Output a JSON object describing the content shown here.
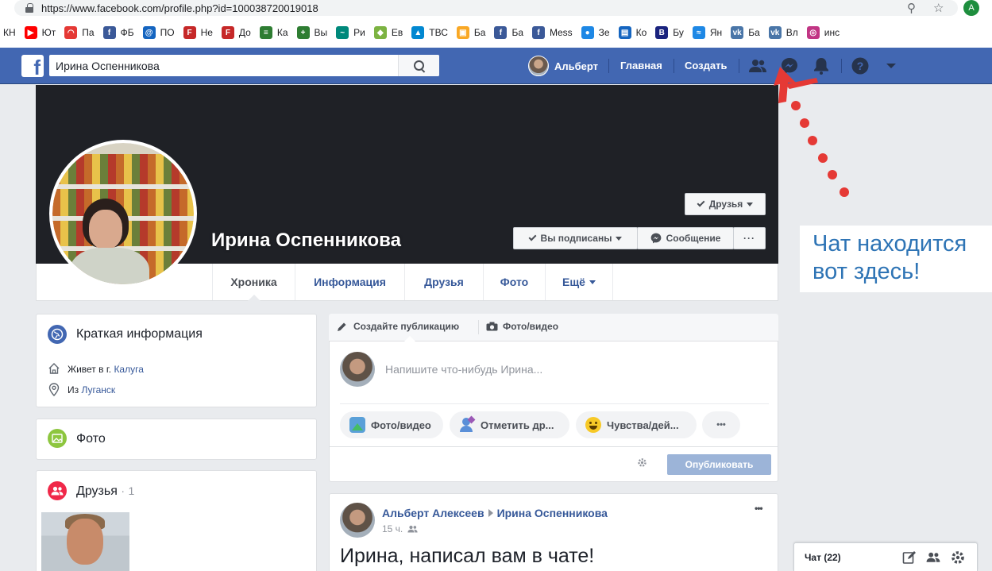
{
  "browser": {
    "url": "https://www.facebook.com/profile.php?id=100038720019018",
    "profile_initial": "A",
    "bookmarks": [
      {
        "label": "КН",
        "icon": "",
        "color": ""
      },
      {
        "label": "Ют",
        "icon": "youtube-icon",
        "color": "#ff0000"
      },
      {
        "label": "Па",
        "icon": "rainbow-icon",
        "color": "#e53935"
      },
      {
        "label": "ФБ",
        "icon": "facebook-icon",
        "color": "#3b5998"
      },
      {
        "label": "ПО",
        "icon": "mail-at-icon",
        "color": "#1565c0"
      },
      {
        "label": "Не",
        "icon": "letter-f-icon",
        "color": "#c62828"
      },
      {
        "label": "До",
        "icon": "letter-f-icon",
        "color": "#c62828"
      },
      {
        "label": "Ка",
        "icon": "stack-icon",
        "color": "#2e7d32"
      },
      {
        "label": "Вы",
        "icon": "plus-icon",
        "color": "#2e7d32"
      },
      {
        "label": "Ри",
        "icon": "brush-icon",
        "color": "#00897b"
      },
      {
        "label": "Ев",
        "icon": "kite-icon",
        "color": "#7cb342"
      },
      {
        "label": "ТВС",
        "icon": "triangle-icon",
        "color": "#0288d1"
      },
      {
        "label": "Ба",
        "icon": "bag-icon",
        "color": "#f9a825"
      },
      {
        "label": "Ба",
        "icon": "facebook-icon",
        "color": "#3b5998"
      },
      {
        "label": "Mess",
        "icon": "facebook-icon",
        "color": "#3b5998"
      },
      {
        "label": "Зе",
        "icon": "globe-icon",
        "color": "#1e88e5"
      },
      {
        "label": "Ко",
        "icon": "photo-icon",
        "color": "#1565c0"
      },
      {
        "label": "Бу",
        "icon": "letter-b-icon",
        "color": "#1a237e"
      },
      {
        "label": "Ян",
        "icon": "wave-icon",
        "color": "#1e88e5"
      },
      {
        "label": "Ба",
        "icon": "vk-icon",
        "color": "#4a76a8"
      },
      {
        "label": "Вл",
        "icon": "vk-icon",
        "color": "#4a76a8"
      },
      {
        "label": "инс",
        "icon": "instagram-icon",
        "color": "#c13584"
      }
    ]
  },
  "fb": {
    "search_value": "Ирина Оспенникова",
    "user_name": "Альберт",
    "nav_home": "Главная",
    "nav_create": "Создать"
  },
  "profile": {
    "name": "Ирина Оспенникова",
    "friends_btn": "Друзья",
    "following_btn": "Вы подписаны",
    "message_btn": "Сообщение",
    "more_btn": "···",
    "tabs": [
      "Хроника",
      "Информация",
      "Друзья",
      "Фото",
      "Ещё"
    ]
  },
  "intro": {
    "title": "Краткая информация",
    "lives_prefix": "Живет в г.",
    "lives_city": "Калуга",
    "from_prefix": "Из",
    "from_city": "Луганск"
  },
  "photos": {
    "title": "Фото"
  },
  "friends": {
    "title": "Друзья",
    "dot": "·",
    "count": "1"
  },
  "composer": {
    "create_post": "Создайте публикацию",
    "photo_video": "Фото/видео",
    "placeholder": "Напишите что-нибудь Ирина...",
    "pill_photo": "Фото/видео",
    "pill_tag": "Отметить др...",
    "pill_feeling": "Чувства/дей...",
    "pill_more": "•••",
    "publish": "Опубликовать"
  },
  "post": {
    "author": "Альберт Алексеев",
    "target": "Ирина Оспенникова",
    "time": "15 ч.",
    "text": "Ирина, написал вам в чате!",
    "menu": "•••"
  },
  "annotation": {
    "line1": "Чат находится",
    "line2": "вот здесь!"
  },
  "chat": {
    "label": "Чат (22)"
  },
  "colors": {
    "fb_blue": "#4267b2",
    "link": "#365899",
    "annotation_red": "#e53935",
    "annotation_text": "#2e74b5"
  }
}
